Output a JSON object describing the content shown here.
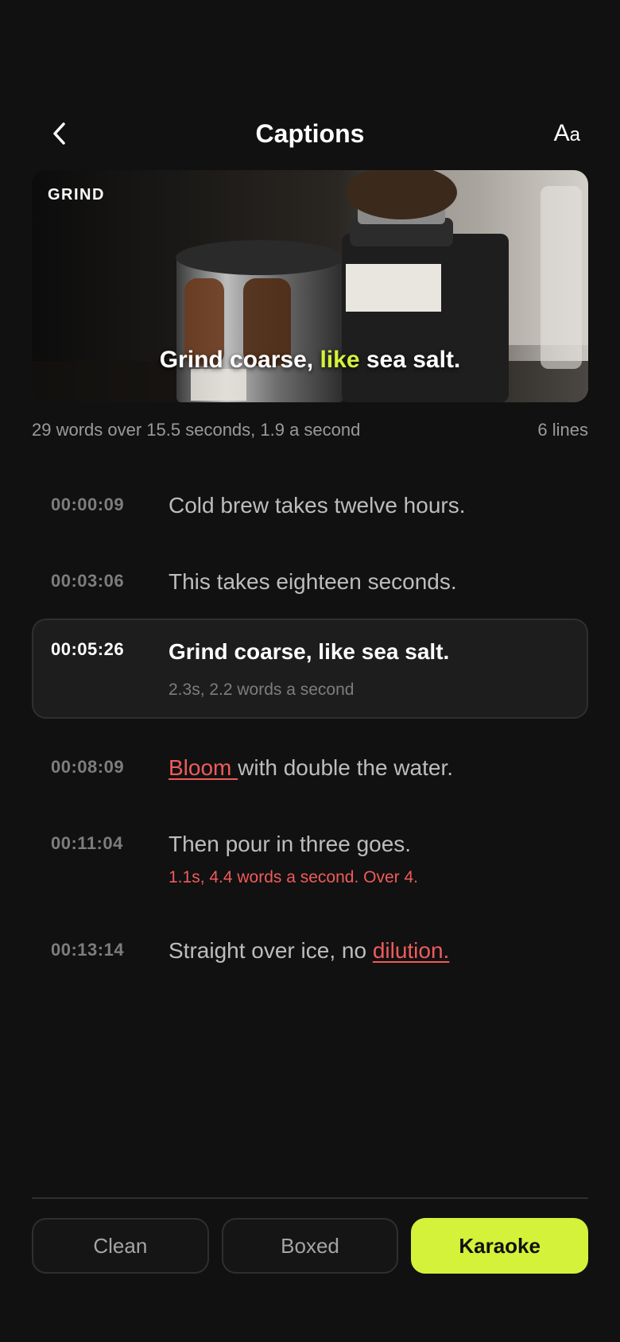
{
  "header": {
    "title": "Captions",
    "font_button": {
      "big": "A",
      "small": "a"
    }
  },
  "preview": {
    "tag": "GRIND",
    "caption_before": "Grind coarse, ",
    "caption_highlight": "like",
    "caption_after": " sea salt."
  },
  "stats": {
    "summary": "29 words over 15.5 seconds, 1.9 a second",
    "lines": "6 lines"
  },
  "cues": [
    {
      "time": "00:00:09",
      "text": "Cold brew takes twelve hours."
    },
    {
      "time": "00:03:06",
      "text": "This takes eighteen seconds."
    },
    {
      "time": "00:05:26",
      "text": "Grind coarse, like sea salt.",
      "meta": "2.3s, 2.2 words a second"
    },
    {
      "time": "00:08:09",
      "flag": "Bloom ",
      "text": "with double the water."
    },
    {
      "time": "00:11:04",
      "text": "Then pour in three goes.",
      "meta": "1.1s, 4.4 words a second. Over 4."
    },
    {
      "time": "00:13:14",
      "text": "Straight over ice, no ",
      "flag": "dilution."
    }
  ],
  "styles": [
    {
      "label": "Clean"
    },
    {
      "label": "Boxed"
    },
    {
      "label": "Karaoke"
    }
  ],
  "colors": {
    "accent": "#d4f23a",
    "warning": "#ef5b5b",
    "background": "#111111"
  },
  "icons": [
    "back-chevron-icon",
    "font-style-icon"
  ]
}
